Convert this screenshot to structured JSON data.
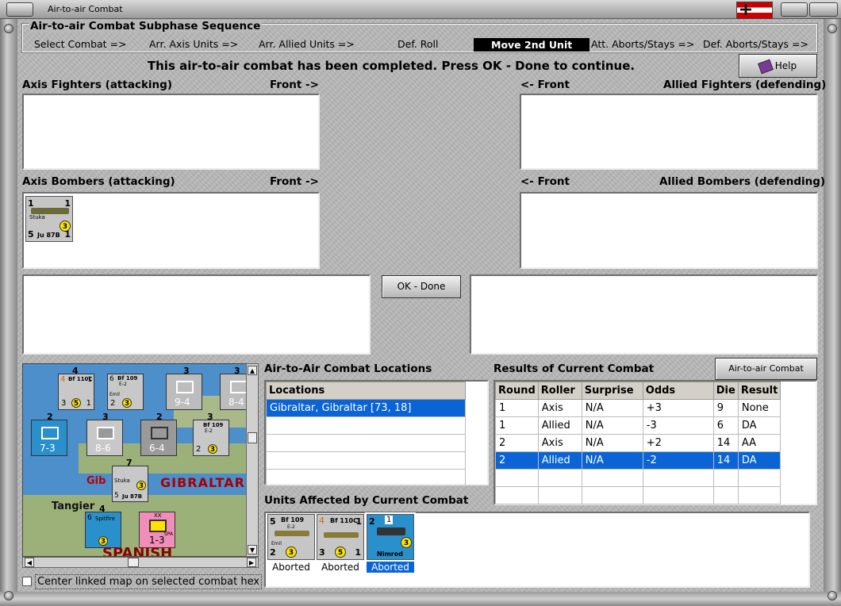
{
  "window": {
    "title": "Air-to-air Combat"
  },
  "sequence": {
    "legend": "Air-to-air Combat Subphase Sequence",
    "steps": [
      "Select Combat =>",
      "Arr. Axis Units =>",
      "Arr. Allied Units =>",
      "Def. Roll",
      "Move 2nd Unit",
      "Att. Aborts/Stays =>",
      "Def. Aborts/Stays =>"
    ],
    "active_index": 4
  },
  "message": "This air-to-air combat has been completed.  Press OK - Done to continue.",
  "help_label": "Help",
  "panels": {
    "axis_fighters": "Axis Fighters (attacking)",
    "axis_front": "Front ->",
    "allied_fighters": "Allied Fighters (defending)",
    "allied_front": "<- Front",
    "axis_bombers": "Axis Bombers (attacking)",
    "allied_bombers": "Allied Bombers (defending)"
  },
  "axis_bomber_unit": {
    "top_left": "1",
    "top_right": "1",
    "name": "Stuka",
    "bottom_left": "5",
    "type": "Ju 87B",
    "bottom_right": "1",
    "badge": "3"
  },
  "ok_done_label": "OK - Done",
  "map": {
    "labels": {
      "gibraltar": "GIBRALTAR",
      "tangier": "Tangier",
      "spanish": "SPANISH",
      "gib_short": "Gib"
    },
    "units": [
      {
        "name": "Bf 110C",
        "left": "4",
        "top_right": "1",
        "b1": "3",
        "badge": "5",
        "b2": "1"
      },
      {
        "name": "Bf 109",
        "sub": "E-2",
        "left": "6",
        "crew": "Emil",
        "b1": "2",
        "badge": "3"
      },
      {
        "values": "9-4"
      },
      {
        "values": "8-4"
      },
      {
        "values": "7-3"
      },
      {
        "values": "8-6"
      },
      {
        "values": "6-4"
      },
      {
        "name": "Bf 109",
        "sub": "E-2",
        "b1": "2",
        "badge": "3"
      },
      {
        "name": "Stuka",
        "b1": "5",
        "type": "Ju 87B",
        "badge": "3",
        "stack": "7"
      },
      {
        "name": "Spitfire",
        "b1": "6",
        "badge": "3"
      },
      {
        "corps": "XX",
        "values": "1-3",
        "nation": "SPA"
      }
    ],
    "stack_counts": [
      "4",
      "3",
      "3",
      "3",
      "2",
      "3",
      "2",
      "3",
      "4"
    ],
    "center_checkbox_label": "Center linked map on selected combat hex"
  },
  "locations": {
    "title": "Air-to-Air Combat Locations",
    "header": "Locations",
    "rows": [
      "Gibraltar, Gibraltar [73, 18]"
    ]
  },
  "results": {
    "title": "Results of Current Combat",
    "chart_button": "Air-to-air Combat Chart",
    "columns": [
      "Round",
      "Roller",
      "Surprise",
      "Odds",
      "Die",
      "Result"
    ],
    "rows": [
      [
        "1",
        "Axis",
        "N/A",
        "+3",
        "9",
        "None"
      ],
      [
        "1",
        "Allied",
        "N/A",
        "-3",
        "6",
        "DA"
      ],
      [
        "2",
        "Axis",
        "N/A",
        "+2",
        "14",
        "AA"
      ],
      [
        "2",
        "Allied",
        "N/A",
        "-2",
        "14",
        "DA"
      ]
    ],
    "selected_row": 3
  },
  "affected": {
    "title": "Units Affected by Current Combat",
    "units": [
      {
        "name": "Bf 109",
        "sub": "E-2",
        "left": "5",
        "crew": "Emil",
        "b1": "2",
        "badge": "3",
        "status": "Aborted"
      },
      {
        "name": "Bf 110C",
        "left": "4",
        "b0": "1",
        "b1": "3",
        "badge": "5",
        "b2": "1",
        "status": "Aborted"
      },
      {
        "name": "Nimrod",
        "left": "2",
        "top": "1",
        "badge": "3",
        "status": "Aborted"
      }
    ]
  }
}
